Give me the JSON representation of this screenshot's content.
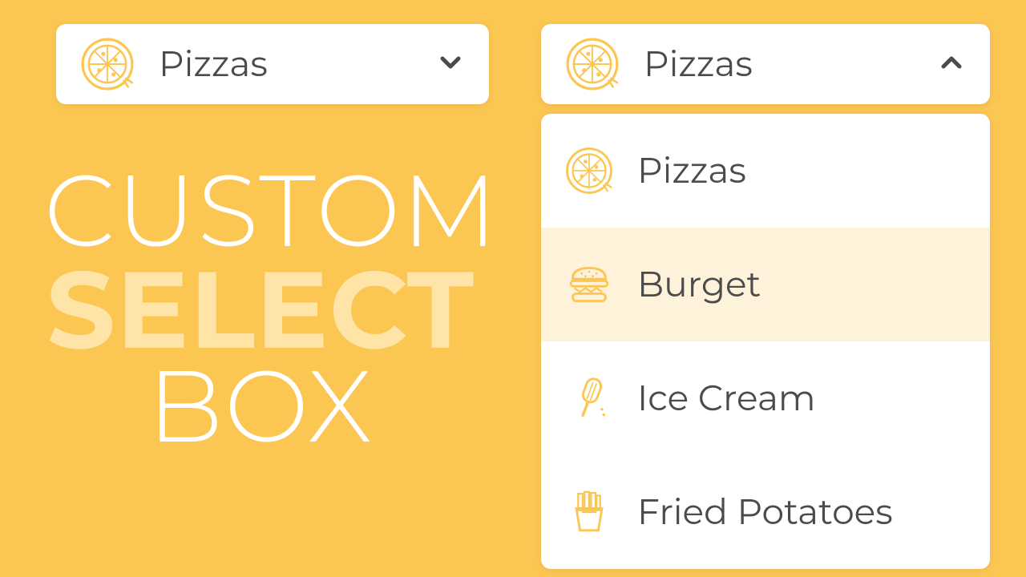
{
  "title": {
    "line1": "CUSTOM",
    "line2": "SELECT",
    "line3": "BOX"
  },
  "closedSelect": {
    "selected": "Pizzas",
    "icon": "pizza"
  },
  "openSelect": {
    "selected": "Pizzas",
    "icon": "pizza",
    "highlightedIndex": 1,
    "options": [
      {
        "label": "Pizzas",
        "icon": "pizza"
      },
      {
        "label": "Burget",
        "icon": "burger"
      },
      {
        "label": "Ice Cream",
        "icon": "icecream"
      },
      {
        "label": "Fried Potatoes",
        "icon": "fries"
      }
    ]
  }
}
